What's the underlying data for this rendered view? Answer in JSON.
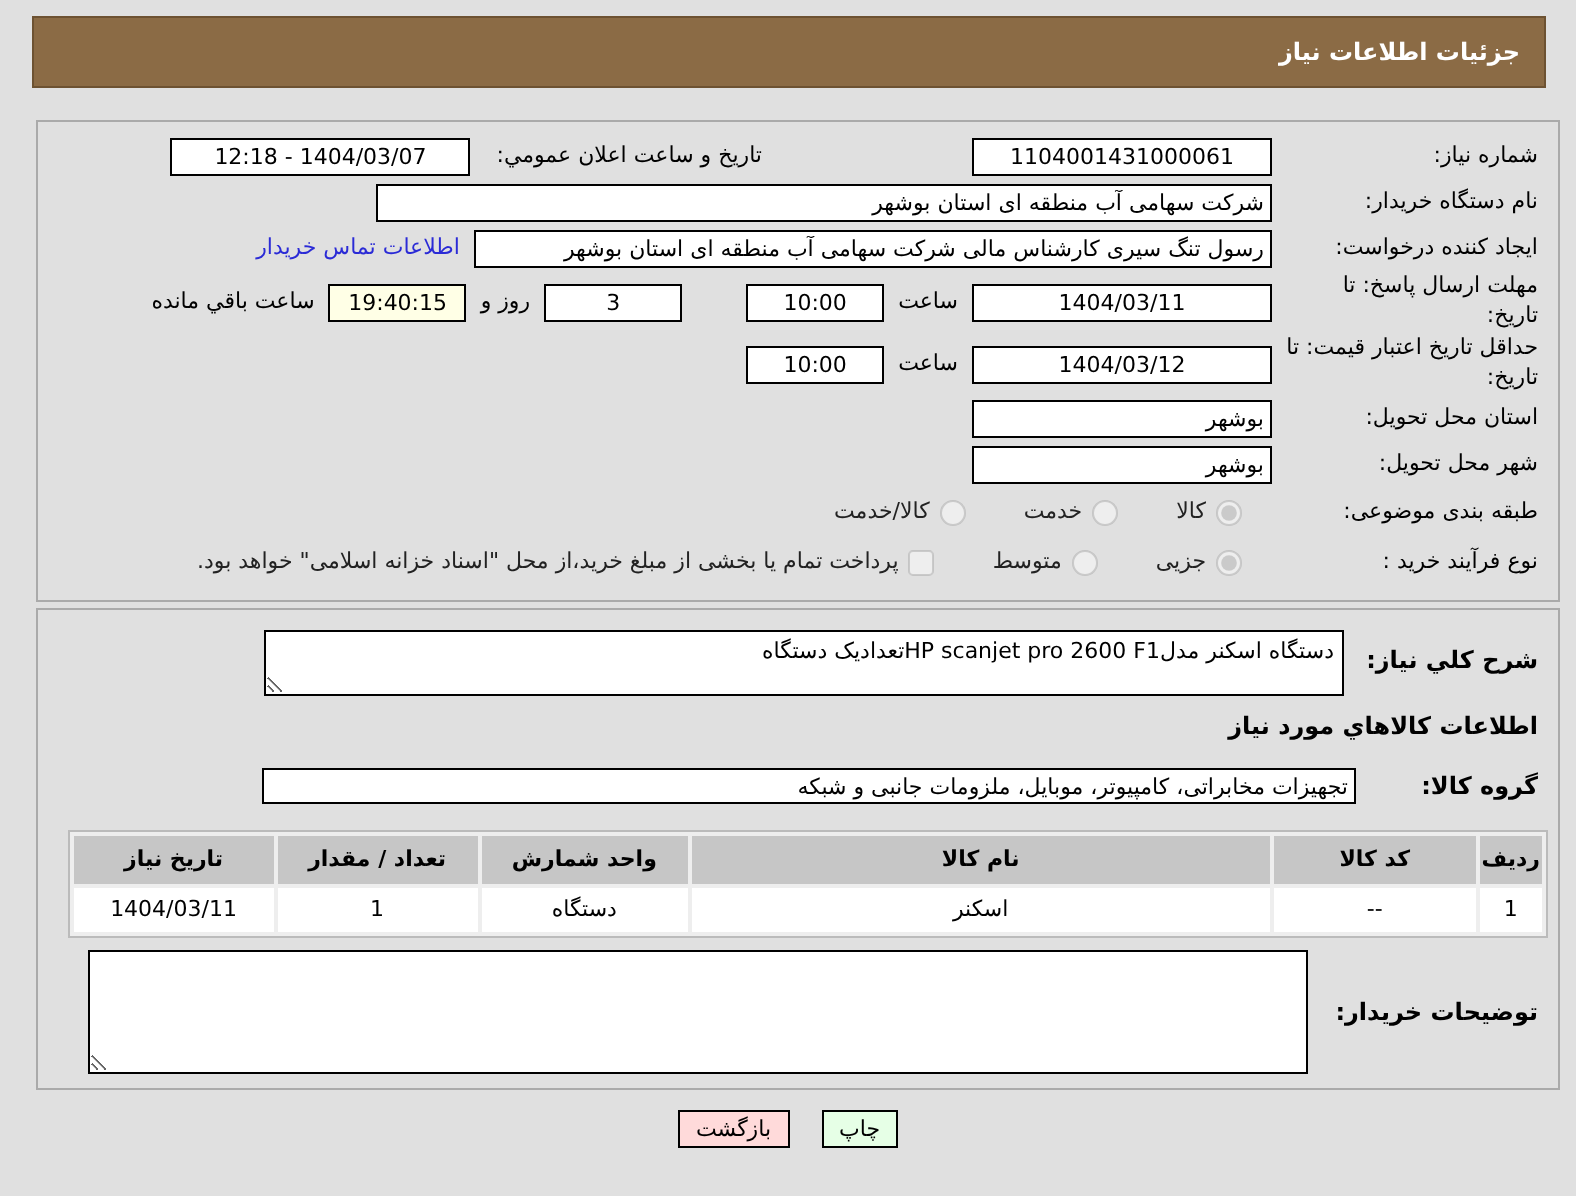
{
  "header": {
    "title": "جزئیات اطلاعات نیاز"
  },
  "need_number": {
    "label": "شماره نیاز:",
    "value": "1104001431000061"
  },
  "announce": {
    "label": "تاریخ و ساعت اعلان عمومي:",
    "value": "1404/03/07 - 12:18"
  },
  "buyer_org": {
    "label": "نام دستگاه خریدار:",
    "value": "شرکت سهامی آب منطقه ای استان بوشهر"
  },
  "requester": {
    "label": "ایجاد کننده درخواست:",
    "value": "رسول تنگ سیری کارشناس مالی شرکت سهامی آب منطقه ای استان بوشهر",
    "link": "اطلاعات تماس خریدار"
  },
  "reply_deadline": {
    "label": "مهلت ارسال پاسخ: تا تاریخ:",
    "date": "1404/03/11",
    "time_label": "ساعت",
    "time": "10:00",
    "days": "3",
    "days_label": "روز و",
    "remaining": "19:40:15",
    "remaining_label": "ساعت باقي مانده"
  },
  "price_validity": {
    "label": "حداقل تاریخ اعتبار قیمت: تا تاریخ:",
    "date": "1404/03/12",
    "time_label": "ساعت",
    "time": "10:00"
  },
  "province": {
    "label": "استان محل تحویل:",
    "value": "بوشهر"
  },
  "city": {
    "label": "شهر محل تحویل:",
    "value": "بوشهر"
  },
  "category": {
    "label": "طبقه بندی موضوعی:",
    "options": [
      {
        "label": "کالا",
        "selected": true
      },
      {
        "label": "خدمت",
        "selected": false
      },
      {
        "label": "کالا/خدمت",
        "selected": false
      }
    ]
  },
  "process": {
    "label": "نوع فرآیند خرید :",
    "options": [
      {
        "label": "جزیی",
        "selected": true
      },
      {
        "label": "متوسط",
        "selected": false
      }
    ],
    "payment": {
      "label": "پرداخت تمام یا بخشی از مبلغ خرید،از محل \"اسناد خزانه اسلامی\" خواهد بود.",
      "checked": false
    }
  },
  "description": {
    "label": "شرح کلي نیاز:",
    "value": "دستگاه اسکنر مدلHP scanjet pro 2600 F1تعدادیک دستگاه"
  },
  "goods_title": "اطلاعات کالاهاي مورد نیاز",
  "goods_group": {
    "label": "گروه کالا:",
    "value": "تجهیزات مخابراتی، کامپیوتر، موبایل، ملزومات جانبی و شبکه"
  },
  "table": {
    "columns": [
      "ردیف",
      "کد کالا",
      "نام کالا",
      "واحد شمارش",
      "تعداد / مقدار",
      "تاریخ نیاز"
    ],
    "rows": [
      [
        "1",
        "--",
        "اسکنر",
        "دستگاه",
        "1",
        "1404/03/11"
      ]
    ]
  },
  "buyer_notes": {
    "label": "توضیحات خریدار:"
  },
  "buttons": [
    {
      "label": "چاپ",
      "kind": "print"
    },
    {
      "label": "بازگشت",
      "kind": "back"
    }
  ]
}
